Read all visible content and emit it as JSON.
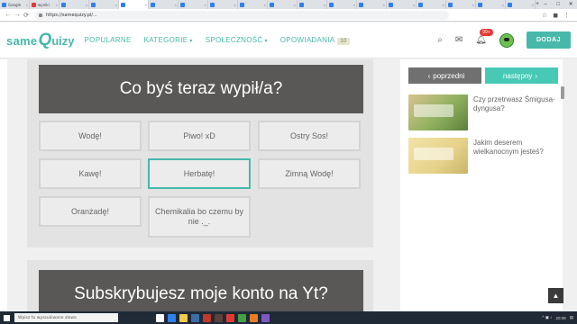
{
  "browser": {
    "tabs": [
      {
        "label": "Google",
        "color": "#2f80ed"
      },
      {
        "label": "wyniki",
        "color": "#e53935"
      },
      {
        "label": "",
        "color": "#2f80ed"
      },
      {
        "label": "",
        "color": "#2f80ed"
      },
      {
        "label": "",
        "color": "#2f80ed"
      },
      {
        "label": "",
        "color": "#2f80ed"
      },
      {
        "label": "",
        "color": "#2f80ed"
      },
      {
        "label": "",
        "color": "#2f80ed"
      },
      {
        "label": "",
        "color": "#2f80ed"
      },
      {
        "label": "",
        "color": "#2f80ed"
      },
      {
        "label": "",
        "color": "#2f80ed"
      },
      {
        "label": "",
        "color": "#2f80ed"
      },
      {
        "label": "",
        "color": "#2f80ed"
      },
      {
        "label": "",
        "color": "#2f80ed"
      },
      {
        "label": "",
        "color": "#2f80ed"
      },
      {
        "label": "",
        "color": "#2f80ed"
      },
      {
        "label": "",
        "color": "#2f80ed"
      },
      {
        "label": "",
        "color": "#2f80ed"
      }
    ],
    "url": "https://samequizy.pl/..."
  },
  "site": {
    "logo": {
      "part1": "same",
      "part2": "Q",
      "part3": "uizy"
    },
    "menu": {
      "popularne": "POPULARNE",
      "kategorie": "KATEGORIE",
      "spolecznosc": "SPOŁECZNOŚĆ",
      "opowiadania": "OPOWIADANIA",
      "opowiadania_count": "10"
    },
    "notification_badge": "99+",
    "add_button": "DODAJ"
  },
  "question1": {
    "title": "Co byś teraz wypił/a?",
    "answers": [
      "Wodę!",
      "Piwo! xD",
      "Ostry Sos!",
      "Kawę!",
      "Herbatę!",
      "Zimną Wodę!",
      "Oranżadę!",
      "Chemikalia bo czemu by nie ._."
    ],
    "selected_index": 4
  },
  "question2": {
    "title": "Subskrybujesz moje konto na Yt?"
  },
  "sidebar": {
    "prev_label": "poprzedni",
    "next_label": "następny",
    "related": [
      {
        "title": "Czy przetrwasz Śmigusa-dyngusa?"
      },
      {
        "title": "Jakim deserem wielkanocnym jesteś?"
      }
    ]
  },
  "taskbar": {
    "search_placeholder": "Wpisz tu wyszukiwane słowa",
    "clock": "20:39"
  }
}
